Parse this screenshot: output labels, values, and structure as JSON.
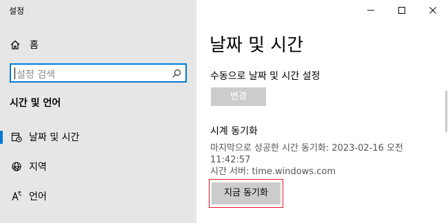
{
  "app": {
    "title": "설정"
  },
  "sidebar": {
    "home_label": "홈",
    "search": {
      "placeholder": "설정 검색"
    },
    "section_header": "시간 및 언어",
    "items": [
      {
        "label": "날짜 및 시간",
        "icon": "calendar-clock-icon",
        "selected": true
      },
      {
        "label": "지역",
        "icon": "globe-icon",
        "selected": false
      },
      {
        "label": "언어",
        "icon": "language-icon",
        "selected": false
      }
    ]
  },
  "main": {
    "title": "날짜 및 시간",
    "manual_setting_label": "수동으로 날짜 및 시간 설정",
    "change_button": "변경",
    "sync_title": "시계 동기화",
    "last_sync": "마지막으로 성공한 시간 동기화: 2023-02-16 오전 11:42:57",
    "time_server": "시간 서버: time.windows.com",
    "sync_button": "지금 동기화"
  },
  "colors": {
    "accent": "#0078d7",
    "highlight_border": "#e81123",
    "sidebar_bg": "#e6e6e6",
    "button_bg": "#cccccc"
  }
}
